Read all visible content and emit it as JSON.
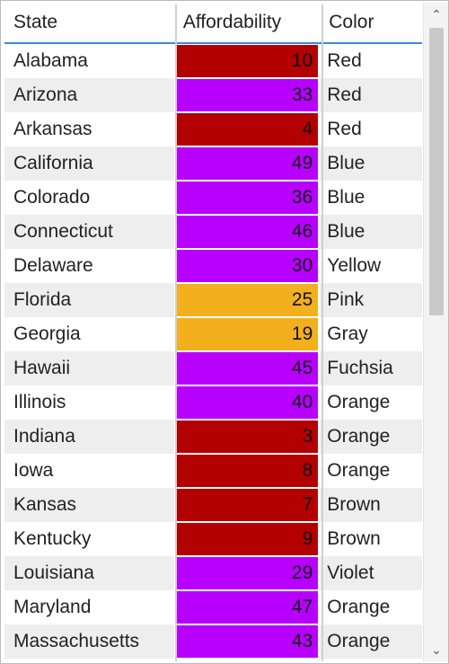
{
  "columns": {
    "state": "State",
    "affordability": "Affordability",
    "color": "Color"
  },
  "rows": [
    {
      "state": "Alabama",
      "aff": 10,
      "aff_bg": "darkred",
      "color": "Red"
    },
    {
      "state": "Arizona",
      "aff": 33,
      "aff_bg": "purple",
      "color": "Red"
    },
    {
      "state": "Arkansas",
      "aff": 4,
      "aff_bg": "darkred",
      "color": "Red"
    },
    {
      "state": "California",
      "aff": 49,
      "aff_bg": "purple",
      "color": "Blue"
    },
    {
      "state": "Colorado",
      "aff": 36,
      "aff_bg": "purple",
      "color": "Blue"
    },
    {
      "state": "Connecticut",
      "aff": 46,
      "aff_bg": "purple",
      "color": "Blue"
    },
    {
      "state": "Delaware",
      "aff": 30,
      "aff_bg": "purple",
      "color": "Yellow"
    },
    {
      "state": "Florida",
      "aff": 25,
      "aff_bg": "amber",
      "color": "Pink"
    },
    {
      "state": "Georgia",
      "aff": 19,
      "aff_bg": "amber",
      "color": "Gray"
    },
    {
      "state": "Hawaii",
      "aff": 45,
      "aff_bg": "purple",
      "color": "Fuchsia"
    },
    {
      "state": "Illinois",
      "aff": 40,
      "aff_bg": "purple",
      "color": "Orange"
    },
    {
      "state": "Indiana",
      "aff": 3,
      "aff_bg": "darkred",
      "color": "Orange"
    },
    {
      "state": "Iowa",
      "aff": 8,
      "aff_bg": "darkred",
      "color": "Orange"
    },
    {
      "state": "Kansas",
      "aff": 7,
      "aff_bg": "darkred",
      "color": "Brown"
    },
    {
      "state": "Kentucky",
      "aff": 9,
      "aff_bg": "darkred",
      "color": "Brown"
    },
    {
      "state": "Louisiana",
      "aff": 29,
      "aff_bg": "purple",
      "color": "Violet"
    },
    {
      "state": "Maryland",
      "aff": 47,
      "aff_bg": "purple",
      "color": "Orange"
    },
    {
      "state": "Massachusetts",
      "aff": 43,
      "aff_bg": "purple",
      "color": "Orange"
    }
  ],
  "scroll": {
    "up_glyph": "⌃",
    "down_glyph": "⌄"
  }
}
